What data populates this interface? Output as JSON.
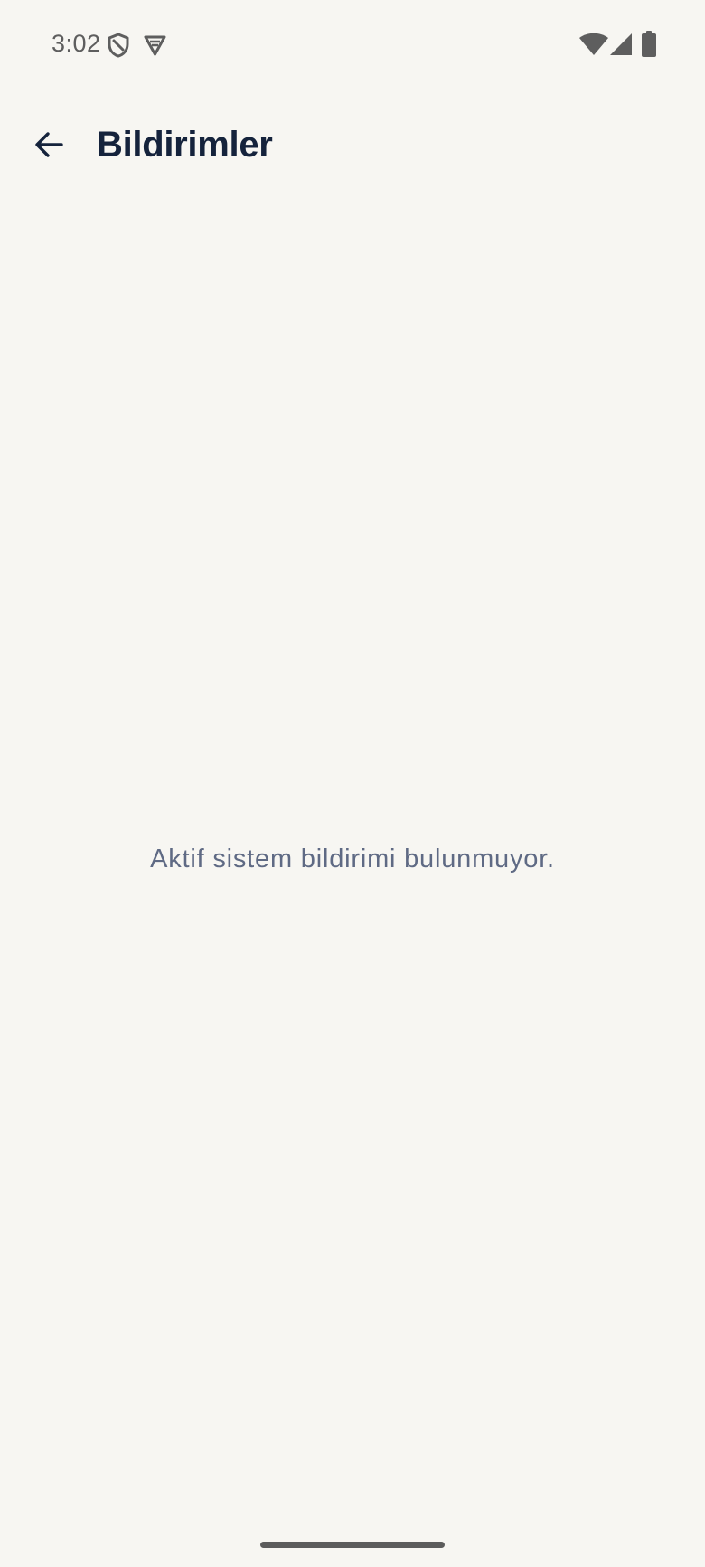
{
  "status_bar": {
    "time": "3:02",
    "icons": [
      "shield-icon",
      "vpn-icon",
      "wifi-icon",
      "signal-icon",
      "battery-icon"
    ],
    "icon_color": "#5E5E5E"
  },
  "app_bar": {
    "back_icon": "arrow-left-icon",
    "title": "Bildirimler"
  },
  "content": {
    "empty_message": "Aktif sistem bildirimi bulunmuyor."
  },
  "colors": {
    "background": "#F7F6F2",
    "title": "#15233C",
    "secondary_text": "#5F6A84"
  }
}
